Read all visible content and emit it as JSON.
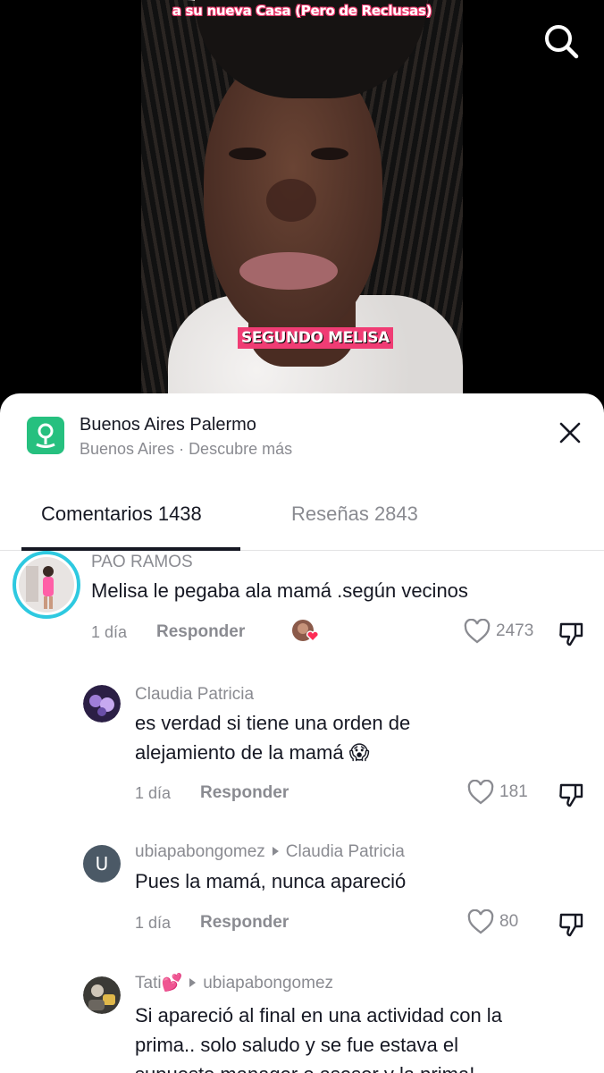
{
  "video": {
    "caption_top_line1": "a su nueva Casa (Pero de Reclusas)",
    "caption_bottom": "SEGUNDO MELISA"
  },
  "location": {
    "title": "Buenos Aires Palermo",
    "subtitle": "Buenos Aires · Descubre más"
  },
  "tabs": [
    {
      "label": "Comentarios 1438",
      "active": true
    },
    {
      "label": "Reseñas 2843",
      "active": false
    }
  ],
  "comments": [
    {
      "user": "PAO RAMOS",
      "text": "Melisa le pegaba ala mamá .según vecinos",
      "date": "1 día",
      "reply_label": "Responder",
      "likes": "2473"
    },
    {
      "user": "Claudia Patricia",
      "text_line1": "es verdad si tiene una orden de",
      "text_line2": "alejamiento de la mamá 😱",
      "date": "1 día",
      "reply_label": "Responder",
      "likes": "181"
    },
    {
      "user": "ubiapabongomez",
      "reply_to": "Claudia Patricia",
      "avatar_letter": "U",
      "text": "Pues la mamá, nunca apareció",
      "date": "1 día",
      "reply_label": "Responder",
      "likes": "80"
    },
    {
      "user": "Tati💕",
      "reply_to": "ubiapabongomez",
      "text_line1": "Si apareció al final en una actividad con la",
      "text_line2": "prima.. solo saludo y se fue estava el",
      "text_line3": "supuesto manager o asesor y la prima!"
    }
  ],
  "colors": {
    "accent_green": "#26c07f",
    "caption_pink": "#f03c74",
    "text_primary": "#161823",
    "text_secondary": "#8a8b91",
    "heart_red": "#fe2c55"
  }
}
